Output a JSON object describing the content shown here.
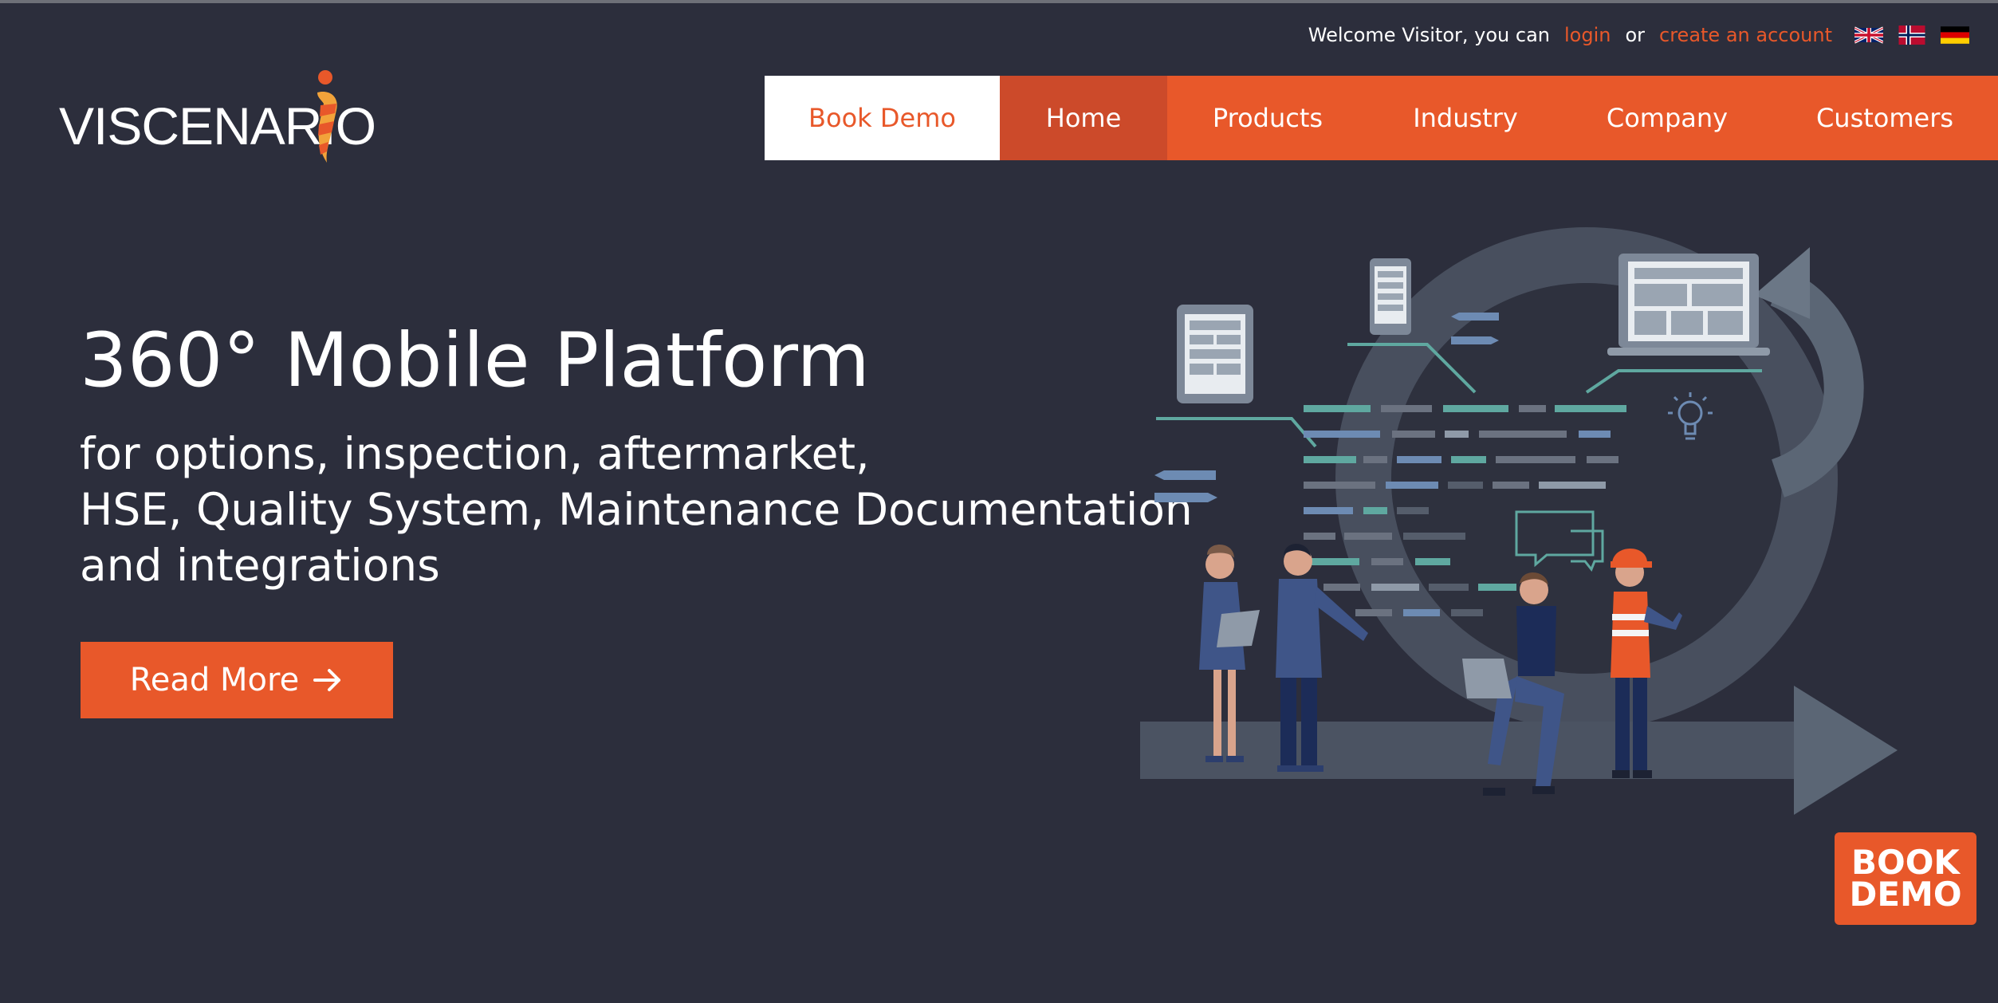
{
  "utility_bar": {
    "welcome_text": "Welcome Visitor, you can",
    "login_label": "login",
    "or_text": "or",
    "create_account_label": "create an account",
    "flags": [
      "uk-flag-icon",
      "norway-flag-icon",
      "germany-flag-icon"
    ]
  },
  "logo": {
    "text": "VISCENARIO"
  },
  "nav": {
    "book_demo": "Book Demo",
    "home": "Home",
    "products": "Products",
    "industry": "Industry",
    "company": "Company",
    "customers": "Customers"
  },
  "hero": {
    "title": "360° Mobile Platform",
    "subtitle_lines": [
      "for options, inspection, aftermarket,",
      "HSE, Quality System, Maintenance Documentation",
      "and integrations"
    ],
    "cta_label": "Read More",
    "cta_icon": "arrow-right-icon"
  },
  "badge": {
    "line1": "BOOK",
    "line2": "DEMO"
  },
  "colors": {
    "background": "#2c2e3c",
    "accent": "#e8582a",
    "nav_active": "#cc4a2a"
  }
}
